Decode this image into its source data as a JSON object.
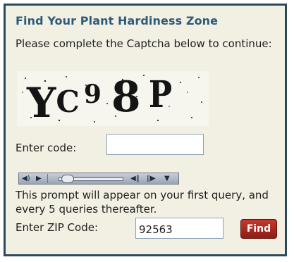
{
  "widget": {
    "title": "Find Your Plant Hardiness Zone",
    "prompt": "Please complete the Captcha below to continue:",
    "captcha_text": "YC98P",
    "enter_code_label": "Enter code:",
    "code_value": "",
    "audio_player": {
      "controls": [
        "volume-icon",
        "play-icon",
        "seek-slider",
        "previous-icon",
        "next-icon",
        "dropdown-icon"
      ]
    },
    "note": "This prompt will appear on your first query, and every 5 queries thereafter.",
    "zip_label": "Enter ZIP Code:",
    "zip_value": "92563",
    "find_button": "Find"
  },
  "colors": {
    "border": "#2d4a5a",
    "background": "#f2f0e3",
    "title": "#2f5a79",
    "find_button": "#a82a20"
  }
}
